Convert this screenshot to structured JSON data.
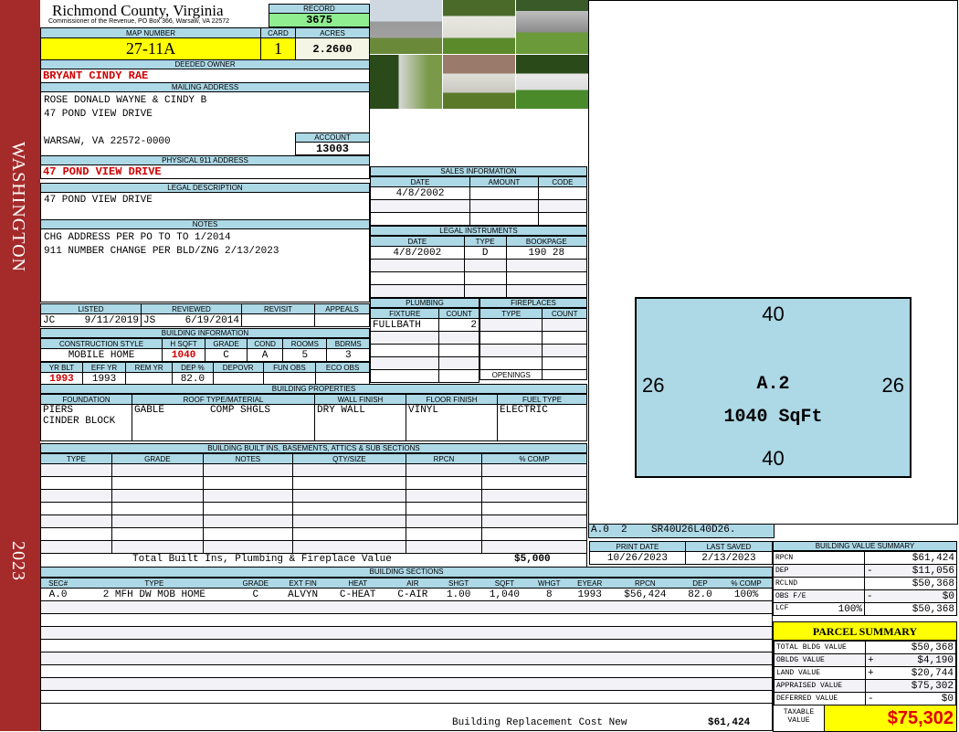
{
  "sidebar": {
    "district": "WASHINGTON",
    "year": "2023"
  },
  "header": {
    "county": "Richmond County, Virginia",
    "subtitle": "Commissioner of the Revenue, PO Box 366, Warsaw, VA 22572",
    "record_label": "RECORD",
    "record": "3675"
  },
  "parcel": {
    "map_label": "MAP NUMBER",
    "map": "27-11A",
    "card_label": "CARD",
    "card": "1",
    "acres_label": "ACRES",
    "acres": "2.2600"
  },
  "owner": {
    "label": "DEEDED OWNER",
    "value": "BRYANT CINDY RAE"
  },
  "mailing": {
    "label": "MAILING ADDRESS",
    "line1": "ROSE DONALD WAYNE & CINDY B",
    "line2": "47 POND VIEW DRIVE",
    "line3": "WARSAW, VA 22572-0000",
    "account_label": "ACCOUNT",
    "account": "13003"
  },
  "physical": {
    "label": "PHYSICAL 911 ADDRESS",
    "value": "47 POND VIEW DRIVE"
  },
  "legal": {
    "label": "LEGAL DESCRIPTION",
    "value": "47 POND VIEW DRIVE"
  },
  "notes": {
    "label": "NOTES",
    "line1": "CHG ADDRESS PER PO TO TO 1/2014",
    "line2": "911 NUMBER CHANGE PER BLD/ZNG 2/13/2023"
  },
  "review": {
    "listed_label": "LISTED",
    "reviewed_label": "REVIEWED",
    "revisit_label": "REVISIT",
    "appeals_label": "APPEALS",
    "listed_by": "JC",
    "listed_date": "9/11/2019",
    "reviewed_by": "JS",
    "reviewed_date": "6/19/2014"
  },
  "building_info": {
    "label": "BUILDING INFORMATION",
    "headers1": [
      "CONSTRUCTION STYLE",
      "H SQFT",
      "GRADE",
      "COND",
      "ROOMS",
      "BDRMS"
    ],
    "values1": [
      "MOBILE HOME",
      "1040",
      "C",
      "A",
      "5",
      "3"
    ],
    "headers2": [
      "YR BLT",
      "EFF YR",
      "REM YR",
      "DEP %",
      "DEPOVR",
      "FUN OBS",
      "ECO OBS"
    ],
    "values2": [
      "1993",
      "1993",
      "",
      "82.0",
      "",
      "",
      ""
    ]
  },
  "sales": {
    "label": "SALES INFORMATION",
    "headers": [
      "DATE",
      "AMOUNT",
      "CODE"
    ],
    "rows": [
      [
        "4/8/2002",
        "",
        ""
      ]
    ]
  },
  "legal_instruments": {
    "label": "LEGAL INSTRUMENTS",
    "headers": [
      "DATE",
      "TYPE",
      "BOOKPAGE"
    ],
    "rows": [
      [
        "4/8/2002",
        "D",
        "190 28"
      ]
    ]
  },
  "plumbing": {
    "label": "PLUMBING",
    "headers": [
      "FIXTURE",
      "COUNT"
    ],
    "rows": [
      [
        "FULLBATH",
        "2"
      ]
    ]
  },
  "fireplaces": {
    "label": "FIREPLACES",
    "headers": [
      "TYPE",
      "COUNT"
    ],
    "openings": "OPENINGS"
  },
  "properties": {
    "label": "BUILDING PROPERTIES",
    "headers": [
      "FOUNDATION",
      "ROOF TYPE/MATERIAL",
      "WALL FINISH",
      "FLOOR FINISH",
      "FUEL TYPE"
    ],
    "foundation1": "PIERS",
    "foundation2": "CINDER BLOCK",
    "roof_type": "GABLE",
    "roof_material": "COMP SHGLS",
    "wall": "DRY WALL",
    "floor": "VINYL",
    "fuel": "ELECTRIC"
  },
  "builtins": {
    "label": "BUILDING BUILT INS, BASEMENTS, ATTICS & SUB SECTIONS",
    "headers": [
      "TYPE",
      "GRADE",
      "NOTES",
      "QTY/SIZE",
      "RPCN",
      "% COMP"
    ],
    "total_label": "Total Built Ins, Plumbing & Fireplace Value",
    "total": "$5,000"
  },
  "sketch": {
    "top": "40",
    "bottom": "40",
    "left": "26",
    "right": "26",
    "section": "A.2",
    "area": "1040 SqFt",
    "code": "A.0  2    SR40U26L40D26."
  },
  "dates": {
    "print_label": "PRINT DATE",
    "print": "10/26/2023",
    "saved_label": "LAST SAVED",
    "saved": "2/13/2023"
  },
  "sections": {
    "label": "BUILDING SECTIONS",
    "headers": [
      "SEC#",
      "TYPE",
      "GRADE",
      "EXT FIN",
      "HEAT",
      "AIR",
      "SHGT",
      "SQFT",
      "WHGT",
      "EYEAR",
      "RPCN",
      "DEP",
      "% COMP"
    ],
    "rows": [
      [
        "A.0",
        "2 MFH DW MOB HOME",
        "C",
        "ALVYN",
        "C-HEAT",
        "C-AIR",
        "1.00",
        "1,040",
        "8",
        "1993",
        "$56,424",
        "82.0",
        "100%"
      ]
    ],
    "total_label": "Building Replacement Cost New",
    "total": "$61,424"
  },
  "value_summary": {
    "label": "BUILDING VALUE SUMMARY",
    "rows": [
      {
        "k": "RPCN",
        "op": "",
        "v": "$61,424"
      },
      {
        "k": "DEP",
        "op": "-",
        "v": "$11,056"
      },
      {
        "k": "RCLND",
        "op": "",
        "v": "$50,368"
      },
      {
        "k": "OBS F/E",
        "op": "-",
        "v": "$0"
      },
      {
        "k": "LCF",
        "pct": "100%",
        "op": "",
        "v": "$50,368"
      }
    ]
  },
  "parcel_summary": {
    "label": "PARCEL SUMMARY",
    "rows": [
      {
        "k": "TOTAL BLDG VALUE",
        "op": "",
        "v": "$50,368"
      },
      {
        "k": "OBLDG VALUE",
        "op": "+",
        "v": "$4,190"
      },
      {
        "k": "LAND VALUE",
        "op": "+",
        "v": "$20,744"
      },
      {
        "k": "APPRAISED VALUE",
        "op": "",
        "v": "$75,302"
      },
      {
        "k": "DEFERRED VALUE",
        "op": "-",
        "v": "$0"
      }
    ],
    "taxable_label": "TAXABLE VALUE",
    "taxable": "$75,302"
  }
}
